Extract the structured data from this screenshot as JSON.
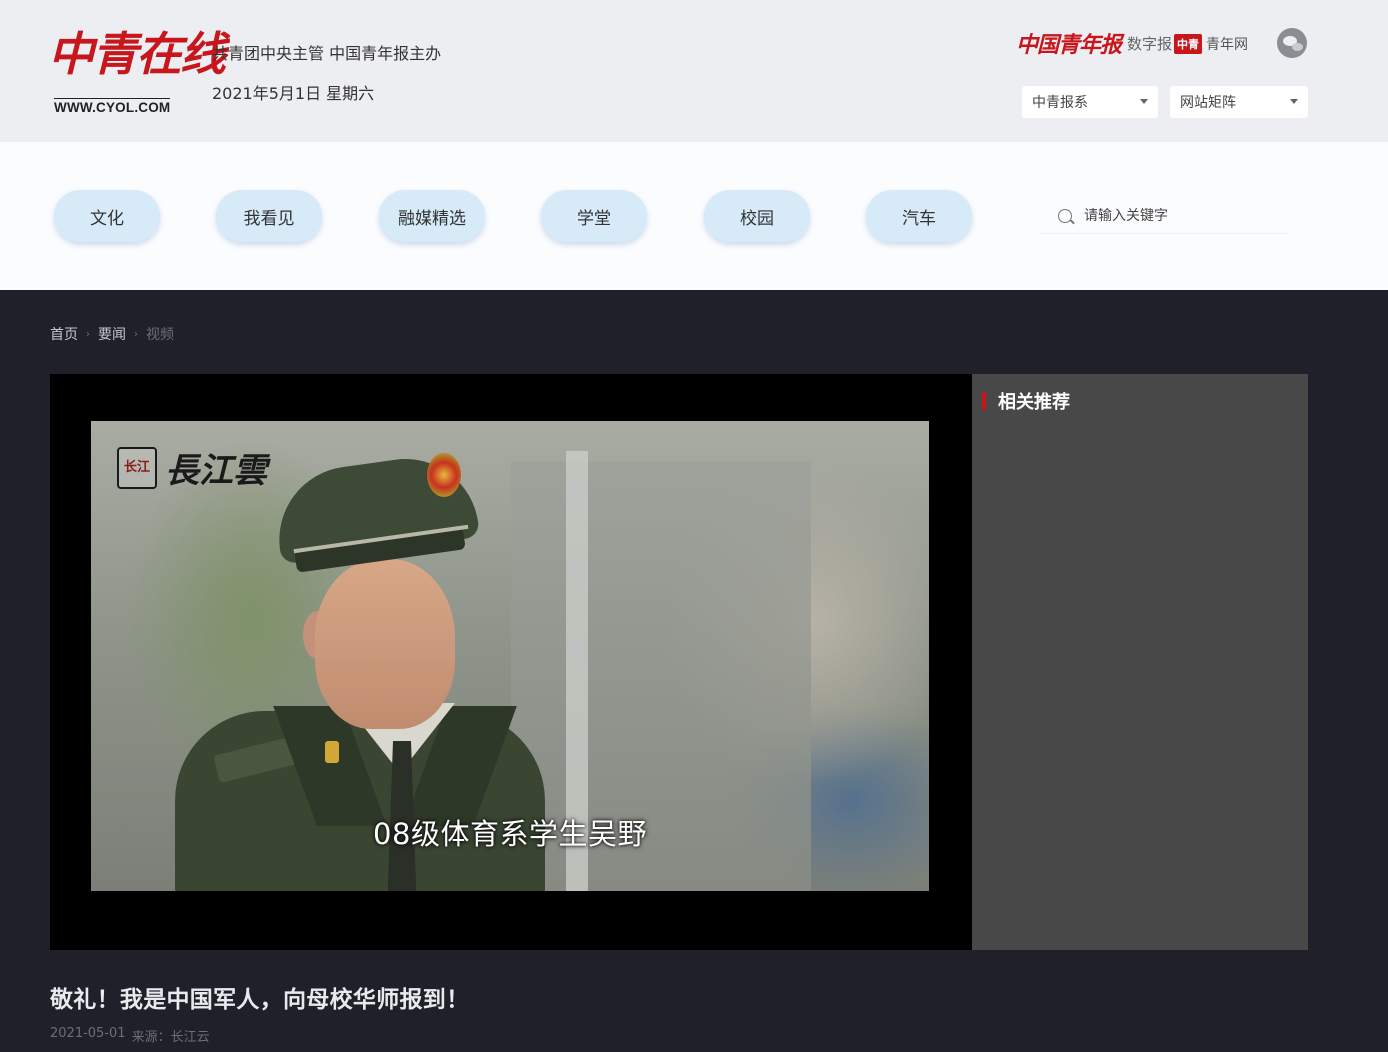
{
  "header": {
    "logo_text": "中青在线",
    "logo_url": "WWW.CYOL.COM",
    "tagline": "共青团中央主管 中国青年报主办",
    "date": "2021年5月1日 星期六",
    "partner_newspaper": {
      "brand": "中国青年报",
      "label": "数字报"
    },
    "partner_site": {
      "badge": "中青",
      "label": "青年网"
    },
    "social_icon": "wechat-icon",
    "selects": [
      {
        "label": "中青报系"
      },
      {
        "label": "网站矩阵"
      }
    ]
  },
  "nav": {
    "items": [
      {
        "label": "文化"
      },
      {
        "label": "我看见"
      },
      {
        "label": "融媒精选"
      },
      {
        "label": "学堂"
      },
      {
        "label": "校园"
      },
      {
        "label": "汽车"
      }
    ],
    "search_placeholder": "请输入关键字"
  },
  "breadcrumb": {
    "items": [
      "首页",
      "要闻",
      "视频"
    ]
  },
  "video": {
    "watermark_seal": "长江",
    "watermark": "長江雲",
    "subtitle": "08级体育系学生吴野"
  },
  "sidebar": {
    "title": "相关推荐"
  },
  "article": {
    "title": "敬礼！我是中国军人，向母校华师报到！",
    "date": "2021-05-01",
    "source": "来源：长江云"
  },
  "colors": {
    "brand_red": "#c8161d",
    "nav_pill": "#d6eaf8",
    "page_dark": "#1f2029",
    "sidebar_bg": "#484848"
  }
}
